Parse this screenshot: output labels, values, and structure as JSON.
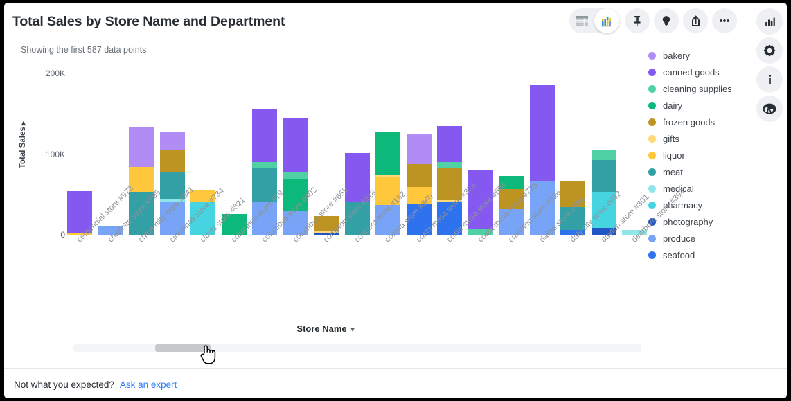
{
  "header": {
    "title": "Total Sales by Store Name and Department",
    "subtitle": "Showing the first 587 data points"
  },
  "toolbar": {
    "items": [
      {
        "name": "table-view-icon",
        "label": "Table view",
        "active": false
      },
      {
        "name": "chart-view-icon",
        "label": "Chart view",
        "active": true
      },
      {
        "name": "pin-icon",
        "label": "Pin",
        "active": false
      },
      {
        "name": "lightbulb-icon",
        "label": "Insights",
        "active": false
      },
      {
        "name": "share-icon",
        "label": "Share",
        "active": false
      },
      {
        "name": "more-options-icon",
        "label": "More options",
        "active": false
      }
    ]
  },
  "rail": {
    "items": [
      {
        "name": "bar-chart-icon",
        "label": "Visualization"
      },
      {
        "name": "gear-icon",
        "label": "Settings"
      },
      {
        "name": "info-icon",
        "label": "Info"
      },
      {
        "name": "r-logo-icon",
        "label": "R"
      }
    ]
  },
  "legend": {
    "items": [
      {
        "label": "bakery",
        "color": "#b18cf5"
      },
      {
        "label": "canned goods",
        "color": "#8558f0"
      },
      {
        "label": "cleaning supplies",
        "color": "#4fd1a5"
      },
      {
        "label": "dairy",
        "color": "#0cb97a"
      },
      {
        "label": "frozen goods",
        "color": "#bd9421"
      },
      {
        "label": "gifts",
        "color": "#ffd977"
      },
      {
        "label": "liquor",
        "color": "#ffc83c"
      },
      {
        "label": "meat",
        "color": "#33a0a6"
      },
      {
        "label": "medical",
        "color": "#8fe5e8"
      },
      {
        "label": "pharmacy",
        "color": "#46d4e0"
      },
      {
        "label": "photography",
        "color": "#1f55c4"
      },
      {
        "label": "produce",
        "color": "#77a4f7"
      },
      {
        "label": "seafood",
        "color": "#2f72ee"
      }
    ]
  },
  "axes": {
    "y_title": "Total Sales",
    "y_ticks": [
      "200K",
      "100K",
      "0"
    ],
    "x_title": "Store Name"
  },
  "scroll": {
    "position": 0.16
  },
  "footer": {
    "text": "Not what you expected?",
    "link": "Ask an expert"
  },
  "chart_data": {
    "type": "bar",
    "stacked": true,
    "title": "Total Sales by Store Name and Department",
    "subtitle": "Showing the first 587 data points",
    "xlabel": "Store Name",
    "ylabel": "Total Sales",
    "ylim": [
      0,
      210000
    ],
    "yticks": [
      0,
      100000,
      200000
    ],
    "grid": false,
    "legend_position": "right",
    "series_colors": {
      "bakery": "#b18cf5",
      "canned goods": "#8558f0",
      "cleaning supplies": "#4fd1a5",
      "dairy": "#0cb97a",
      "frozen goods": "#bd9421",
      "gifts": "#ffd977",
      "liquor": "#ffc83c",
      "meat": "#33a0a6",
      "medical": "#8fe5e8",
      "pharmacy": "#46d4e0",
      "photography": "#1f55c4",
      "produce": "#77a4f7",
      "seafood": "#2f72ee"
    },
    "categories": [
      "centennial store #973",
      "charlotte store #795",
      "chino hills store #341",
      "cincinnati store #734",
      "clovis store #821",
      "columbus store #19",
      "columbus store #402",
      "columbus store #669",
      "compton store #818",
      "concord store #192",
      "corona store #360",
      "costa mesa store #324",
      "costa mesa store #594",
      "costa mesa store #725",
      "cranston store #326",
      "dallas store #436",
      "daly city store #882",
      "dayton store #801",
      "dearborn store #394"
    ],
    "bars": [
      {
        "category": "centennial store #973",
        "total": 54000,
        "segments": [
          {
            "name": "liquor",
            "value": 3000
          },
          {
            "name": "canned goods",
            "value": 51000
          }
        ]
      },
      {
        "category": "charlotte store #795",
        "total": 10000,
        "segments": [
          {
            "name": "produce",
            "value": 10000
          }
        ]
      },
      {
        "category": "chino hills store #341",
        "total": 134000,
        "segments": [
          {
            "name": "meat",
            "value": 53000
          },
          {
            "name": "liquor",
            "value": 31000
          },
          {
            "name": "bakery",
            "value": 50000
          }
        ]
      },
      {
        "category": "cincinnati store #734",
        "total": 127000,
        "segments": [
          {
            "name": "produce",
            "value": 40000
          },
          {
            "name": "medical",
            "value": 4000
          },
          {
            "name": "meat",
            "value": 33000
          },
          {
            "name": "frozen goods",
            "value": 28000
          },
          {
            "name": "bakery",
            "value": 22000
          }
        ]
      },
      {
        "category": "clovis store #821",
        "total": 56000,
        "segments": [
          {
            "name": "pharmacy",
            "value": 40000
          },
          {
            "name": "liquor",
            "value": 16000
          }
        ]
      },
      {
        "category": "columbus store #19",
        "total": 26000,
        "segments": [
          {
            "name": "dairy",
            "value": 26000
          }
        ]
      },
      {
        "category": "columbus store #402",
        "total": 155000,
        "segments": [
          {
            "name": "produce",
            "value": 40000
          },
          {
            "name": "meat",
            "value": 42000
          },
          {
            "name": "cleaning supplies",
            "value": 8000
          },
          {
            "name": "canned goods",
            "value": 65000
          }
        ]
      },
      {
        "category": "columbus store #669",
        "total": 145000,
        "segments": [
          {
            "name": "produce",
            "value": 30000
          },
          {
            "name": "dairy",
            "value": 39000
          },
          {
            "name": "cleaning supplies",
            "value": 9000
          },
          {
            "name": "canned goods",
            "value": 67000
          }
        ]
      },
      {
        "category": "compton store #818",
        "total": 23000,
        "segments": [
          {
            "name": "photography",
            "value": 3000
          },
          {
            "name": "gifts",
            "value": 2000
          },
          {
            "name": "frozen goods",
            "value": 18000
          }
        ]
      },
      {
        "category": "concord store #192",
        "total": 101000,
        "segments": [
          {
            "name": "meat",
            "value": 41000
          },
          {
            "name": "canned goods",
            "value": 60000
          }
        ]
      },
      {
        "category": "corona store #360",
        "total": 128000,
        "segments": [
          {
            "name": "produce",
            "value": 37000
          },
          {
            "name": "liquor",
            "value": 34000
          },
          {
            "name": "gifts",
            "value": 4000
          },
          {
            "name": "dairy",
            "value": 53000
          }
        ]
      },
      {
        "category": "costa mesa store #324",
        "total": 125000,
        "segments": [
          {
            "name": "seafood",
            "value": 39000
          },
          {
            "name": "liquor",
            "value": 20000
          },
          {
            "name": "frozen goods",
            "value": 29000
          },
          {
            "name": "bakery",
            "value": 37000
          }
        ]
      },
      {
        "category": "costa mesa store #594",
        "total": 135000,
        "segments": [
          {
            "name": "seafood",
            "value": 40000
          },
          {
            "name": "gifts",
            "value": 3000
          },
          {
            "name": "frozen goods",
            "value": 40000
          },
          {
            "name": "cleaning supplies",
            "value": 7000
          },
          {
            "name": "canned goods",
            "value": 45000
          }
        ]
      },
      {
        "category": "costa mesa store #725",
        "total": 80000,
        "segments": [
          {
            "name": "cleaning supplies",
            "value": 7000
          },
          {
            "name": "canned goods",
            "value": 73000
          }
        ]
      },
      {
        "category": "cranston store #326",
        "total": 73000,
        "segments": [
          {
            "name": "produce",
            "value": 32000
          },
          {
            "name": "frozen goods",
            "value": 25000
          },
          {
            "name": "dairy",
            "value": 16000
          }
        ]
      },
      {
        "category": "dallas store #436",
        "total": 185000,
        "segments": [
          {
            "name": "produce",
            "value": 67000
          },
          {
            "name": "canned goods",
            "value": 118000
          }
        ]
      },
      {
        "category": "daly city store #882",
        "total": 66000,
        "segments": [
          {
            "name": "seafood",
            "value": 6000
          },
          {
            "name": "meat",
            "value": 28000
          },
          {
            "name": "frozen goods",
            "value": 32000
          }
        ]
      },
      {
        "category": "dayton store #801",
        "total": 105000,
        "segments": [
          {
            "name": "photography",
            "value": 9000
          },
          {
            "name": "pharmacy",
            "value": 44000
          },
          {
            "name": "meat",
            "value": 40000
          },
          {
            "name": "cleaning supplies",
            "value": 12000
          }
        ]
      },
      {
        "category": "dearborn store #394",
        "total": 6000,
        "segments": [
          {
            "name": "medical",
            "value": 6000
          }
        ]
      }
    ]
  }
}
